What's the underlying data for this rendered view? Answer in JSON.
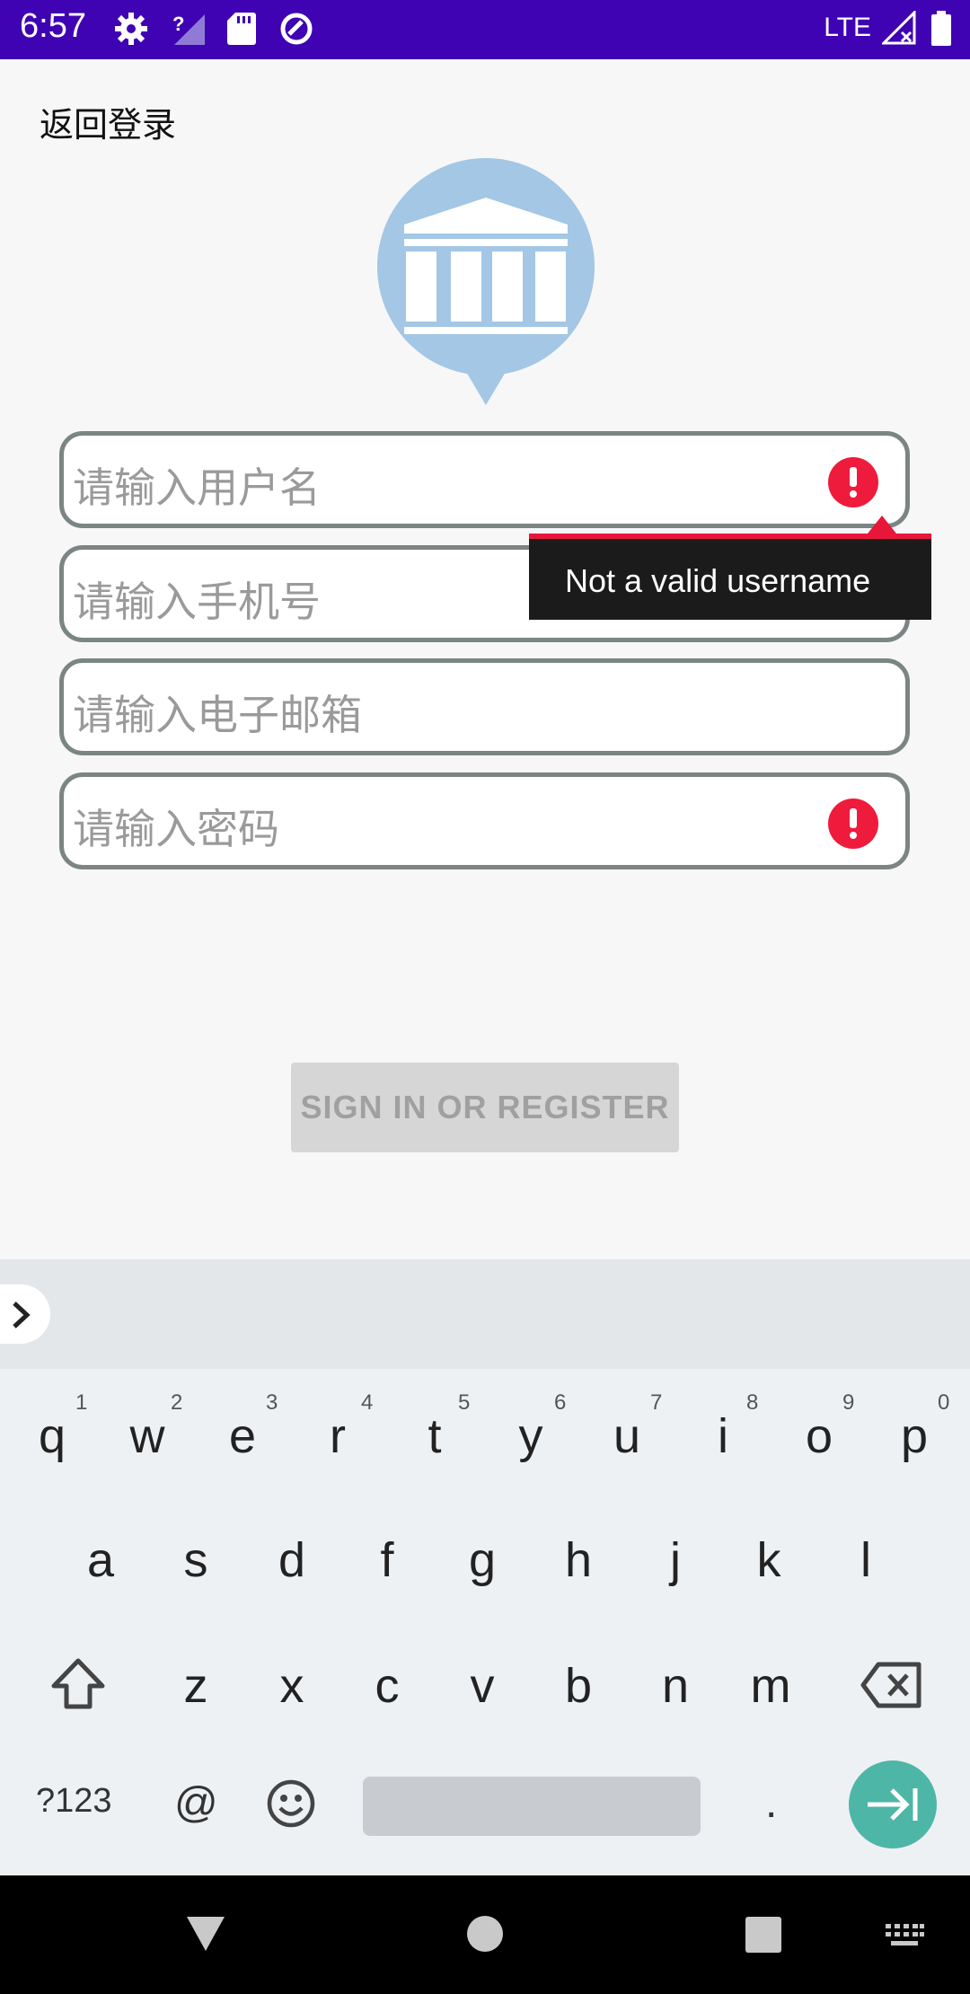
{
  "status_bar": {
    "time": "6:57",
    "network": "LTE"
  },
  "header": {
    "back_label": "返回登录"
  },
  "form": {
    "username_placeholder": "请输入用户名",
    "phone_placeholder": "请输入手机号",
    "email_placeholder": "请输入电子邮箱",
    "password_placeholder": "请输入密码",
    "error_tooltip": "Not a valid username",
    "error_color": "#ef1b3c"
  },
  "actions": {
    "sign_in_label": "SIGN IN OR REGISTER"
  },
  "keyboard": {
    "row1": [
      "q",
      "w",
      "e",
      "r",
      "t",
      "y",
      "u",
      "i",
      "o",
      "p"
    ],
    "row1_hints": [
      "1",
      "2",
      "3",
      "4",
      "5",
      "6",
      "7",
      "8",
      "9",
      "0"
    ],
    "row2": [
      "a",
      "s",
      "d",
      "f",
      "g",
      "h",
      "j",
      "k",
      "l"
    ],
    "row3": [
      "z",
      "x",
      "c",
      "v",
      "b",
      "n",
      "m"
    ],
    "symbols_label": "?123",
    "at_label": "@",
    "period_label": ".",
    "accent_color": "#4db6a7"
  },
  "icons": {
    "status": [
      "gear-icon",
      "signal-question-icon",
      "sd-card-icon",
      "sync-icon",
      "signal-x-icon",
      "battery-icon"
    ],
    "logo": "bank-location-pin-icon",
    "nav": [
      "back-triangle-icon",
      "home-circle-icon",
      "recents-square-icon",
      "keyboard-icon"
    ]
  }
}
